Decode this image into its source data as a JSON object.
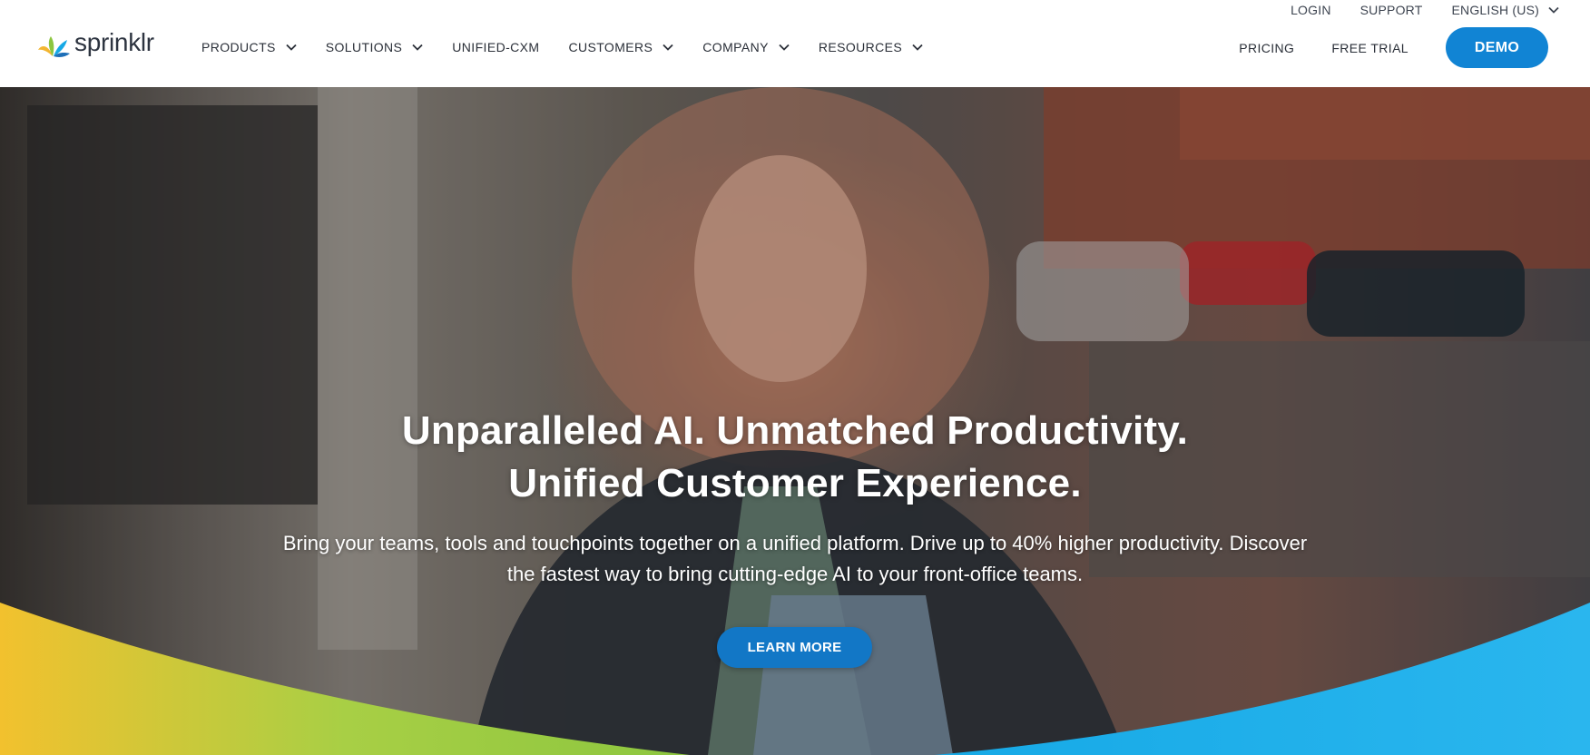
{
  "header": {
    "logo_text": "sprinklr",
    "utility": {
      "login": "LOGIN",
      "support": "SUPPORT",
      "language": "ENGLISH (US)"
    },
    "nav": [
      {
        "label": "PRODUCTS",
        "has_dropdown": true
      },
      {
        "label": "SOLUTIONS",
        "has_dropdown": true
      },
      {
        "label": "UNIFIED-CXM",
        "has_dropdown": false
      },
      {
        "label": "CUSTOMERS",
        "has_dropdown": true
      },
      {
        "label": "COMPANY",
        "has_dropdown": true
      },
      {
        "label": "RESOURCES",
        "has_dropdown": true
      }
    ],
    "pricing": "PRICING",
    "free_trial": "FREE TRIAL",
    "demo": "DEMO"
  },
  "hero": {
    "headline_line1": "Unparalleled AI. Unmatched Productivity.",
    "headline_line2": "Unified Customer Experience.",
    "subtext_line1": "Bring your teams, tools and touchpoints together on a unified platform. Drive up to 40% higher productivity. Discover",
    "subtext_line2": "the fastest way to bring cutting-edge AI to your front-office teams.",
    "cta": "LEARN MORE"
  },
  "colors": {
    "brand_blue": "#1184d4",
    "cta_blue": "#1277c6",
    "wave_green": "#8cc63f",
    "wave_yellow": "#f2c12e",
    "wave_blue": "#16a9e6"
  }
}
